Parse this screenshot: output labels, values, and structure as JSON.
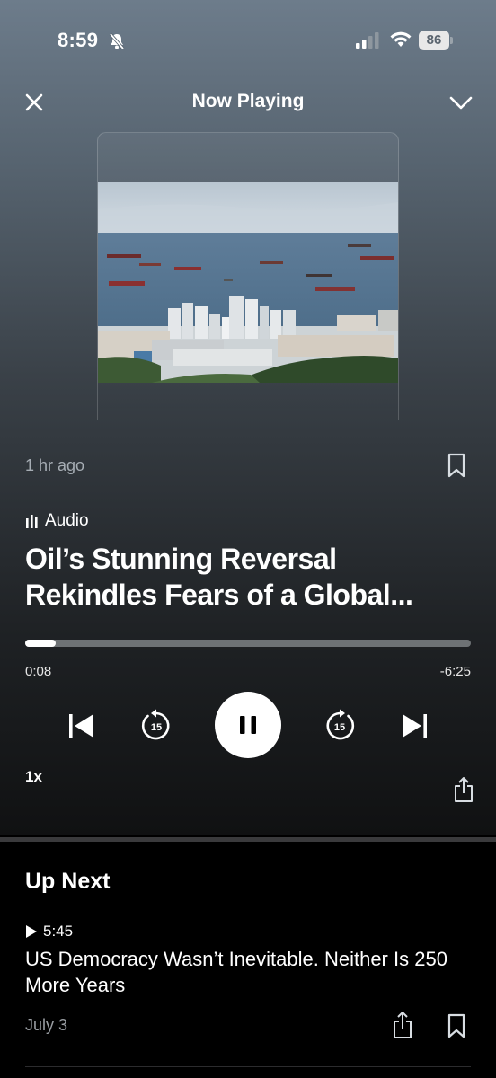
{
  "status_bar": {
    "time": "8:59",
    "battery": "86"
  },
  "header": {
    "title": "Now Playing"
  },
  "episode": {
    "time_ago": "1 hr ago",
    "type_label": "Audio",
    "title": "Oil’s Stunning Reversal Rekindles Fears of a Global..."
  },
  "playback": {
    "progress_fraction": 0.02,
    "elapsed": "0:08",
    "remaining": "-6:25",
    "skip_back_seconds": "15",
    "skip_forward_seconds": "15",
    "speed": "1x",
    "state": "playing"
  },
  "up_next": {
    "heading": "Up Next",
    "duration": "5:45",
    "headline": "US Democracy Wasn’t Inevitable. Neither Is 250 More Years",
    "date": "July 3"
  },
  "icons": [
    "bell-slash-icon",
    "signal-icon",
    "wifi-icon",
    "battery-icon",
    "close-icon",
    "chevron-down-icon",
    "bookmark-icon",
    "audio-bars-icon",
    "skip-previous-icon",
    "rewind-15-icon",
    "pause-icon",
    "forward-15-icon",
    "skip-next-icon",
    "share-icon",
    "play-icon"
  ],
  "colors": {
    "accent": "#ffffff",
    "muted_text": "#a6adb4",
    "track": "#6e7275"
  }
}
